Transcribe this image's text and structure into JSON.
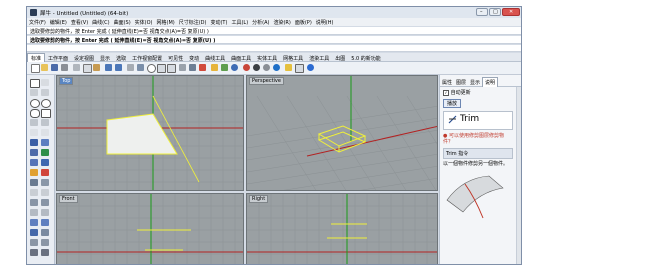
{
  "window": {
    "title": "犀牛 - Untitled (Untitled) (64-bit)",
    "controls": {
      "min": "–",
      "max": "□",
      "close": "✕"
    }
  },
  "menu": [
    "文件(F)",
    "编辑(E)",
    "查看(V)",
    "曲线(C)",
    "曲面(S)",
    "实体(O)",
    "网格(M)",
    "尺寸标注(D)",
    "变动(T)",
    "工具(L)",
    "分析(A)",
    "渲染(R)",
    "面板(P)",
    "说明(H)"
  ],
  "command_history": [
    "选取要修剪的物件，按 Enter 完成 ( 延伸直线(E)=否  视角交点(A)=否  复原(U) )",
    "选取要修剪的物件，按 Enter 完成 ( 延伸直线(E)=否  视角交点(A)=否  复原(U) )"
  ],
  "tabs": [
    "标准",
    "工作平面",
    "设定视图",
    "显示",
    "选取",
    "工作视窗配置",
    "可见性",
    "变动",
    "曲线工具",
    "曲面工具",
    "实体工具",
    "网格工具",
    "渲染工具",
    "出图",
    "5.0 的新功能"
  ],
  "active_tab_index": 0,
  "viewports": [
    {
      "name": "Top",
      "active": true
    },
    {
      "name": "Perspective",
      "active": false
    },
    {
      "name": "Front",
      "active": false
    },
    {
      "name": "Right",
      "active": false
    }
  ],
  "right_panel": {
    "tabs": [
      "属性",
      "图层",
      "显示",
      "说明"
    ],
    "active_tab_index": 3,
    "auto_update_label": "自动更新",
    "auto_update_checked": true,
    "play_button": "播放",
    "command_word": "Trim",
    "tip_text": "可以使用修剪图层修剪物件？",
    "command_header": "Trim 指令",
    "description": "以一個物件修剪另一個物件。"
  },
  "colors": {
    "viewport_bg": "#9aa0a3",
    "grid_line": "#8b9194",
    "axis_red": "#b22222",
    "axis_green": "#1a9a1a",
    "selected_yellow": "#f0f03a",
    "surface_fill": "#eef0ee",
    "active_label": "#5a86c2"
  },
  "icons": [
    "new-file-icon",
    "open-icon",
    "save-icon",
    "print-icon",
    "cut-icon",
    "copy-icon",
    "paste-icon",
    "undo-icon",
    "redo-icon",
    "pan-icon",
    "rotate-icon",
    "zoom-icon",
    "zoom-window-icon",
    "zoom-extents-icon",
    "grid-icon",
    "select-icon",
    "layer-icon",
    "material-icon",
    "light-icon",
    "render-icon",
    "help-icon"
  ]
}
